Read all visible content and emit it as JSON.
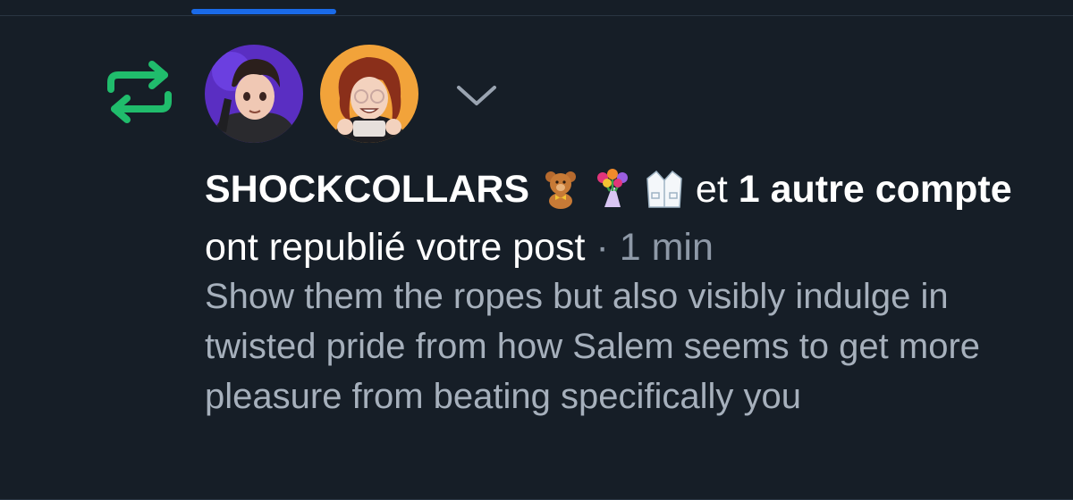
{
  "tabs": {
    "active_indicator_color": "#1a6ae8"
  },
  "notification": {
    "type_icon": "repost-icon",
    "accent_color": "#20bc6c",
    "avatars": [
      {
        "name": "avatar-shockcollars",
        "background": "#5a2ec2"
      },
      {
        "name": "avatar-second-account",
        "background": "#f2a33a"
      }
    ],
    "expand_icon": "chevron-down-icon",
    "actor_name": "SHOCKCOLLARS",
    "actor_emojis": [
      "teddy-bear",
      "bouquet",
      "lab-coat"
    ],
    "connector": "et",
    "others_count_label": "1 autre compte",
    "action_text": "ont republié votre post",
    "separator": "·",
    "time": "1 min",
    "post_text": "Show them the ropes but also visibly indulge in twisted pride from how Salem seems to get more pleasure from beating specifically you"
  }
}
